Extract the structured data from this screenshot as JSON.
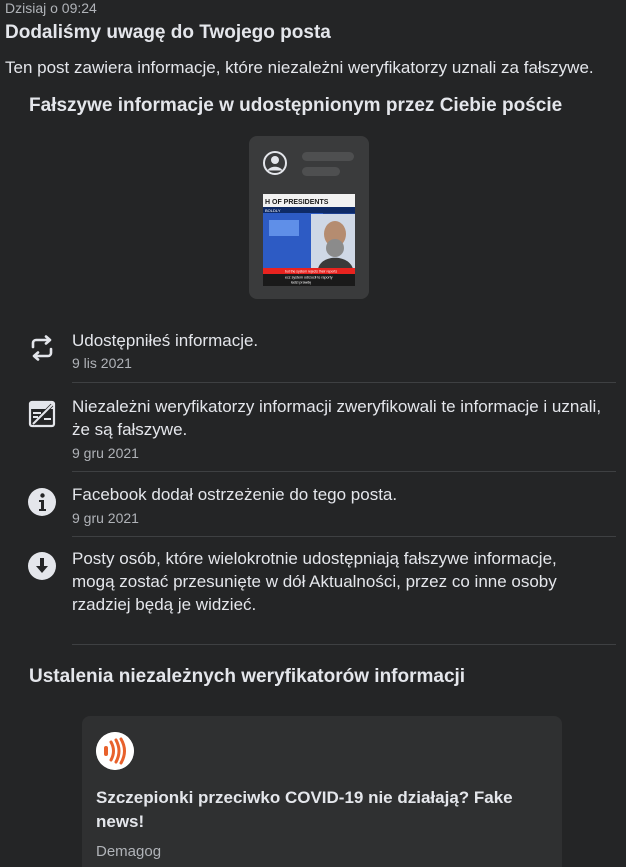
{
  "notification": {
    "timestamp": "Dzisiaj o 09:24",
    "headline": "Dodaliśmy uwagę do Twojego posta",
    "subline": "Ten post zawiera informacje, które niezależni weryfikatorzy uznali za fałszywe."
  },
  "post_section": {
    "title": "Fałszywe informacje w udostępnionym przez Ciebie poście",
    "thumbnail": {
      "banner_text": "H OF PRESIDENTS",
      "small_text": "BOLDLY",
      "caption_line1": "but the system rejects their reports",
      "caption_line2": "ecz system odrzucił te raporty",
      "caption_line3": "ładzi prawdę"
    }
  },
  "timeline": [
    {
      "icon": "share-icon",
      "text": "Udostępniłeś informacje.",
      "date": "9 lis 2021"
    },
    {
      "icon": "fact-check-icon",
      "text": "Niezależni weryfikatorzy informacji zweryfikowali te informacje i uznali, że są fałszywe.",
      "date": "9 gru 2021"
    },
    {
      "icon": "info-icon",
      "text": "Facebook dodał ostrzeżenie do tego posta.",
      "date": "9 gru 2021"
    },
    {
      "icon": "down-arrow-icon",
      "text": "Posty osób, które wielokrotnie udostępniają fałszywe informacje, mogą zostać przesunięte w dół Aktualności, przez co inne osoby rzadziej będą je widzieć."
    }
  ],
  "fact_check_section": {
    "title": "Ustalenia niezależnych weryfikatorów informacji",
    "card": {
      "logo_icon": "demagog-logo-icon",
      "title": "Szczepionki przeciwko COVID-19 nie działają? Fake news!",
      "source": "Demagog"
    }
  },
  "colors": {
    "background": "#242526",
    "card": "#3a3b3c",
    "text_primary": "#e4e6eb",
    "text_secondary": "#b0b3b8",
    "logo_orange": "#e8612c"
  }
}
